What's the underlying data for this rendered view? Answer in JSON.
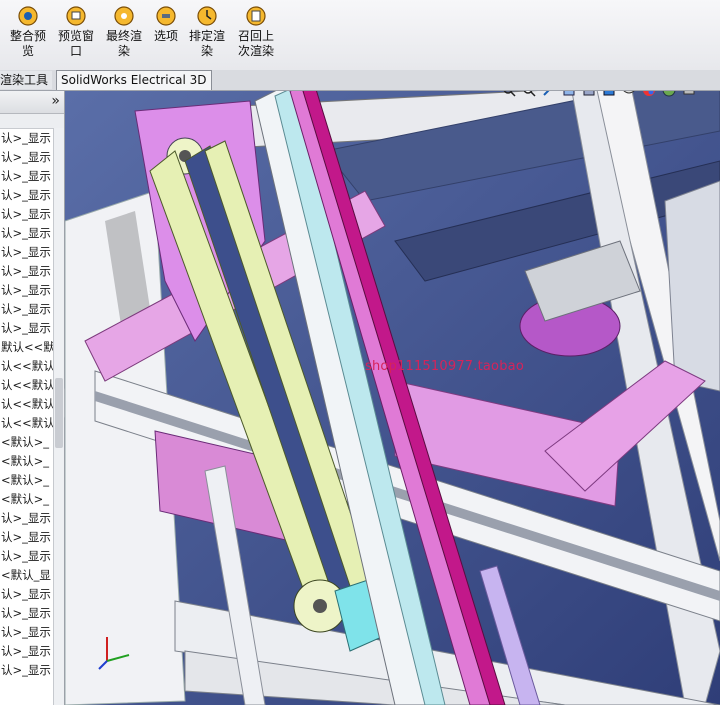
{
  "ribbon": {
    "buttons": [
      {
        "label": "整合预\n览",
        "icon": "integrated-preview-icon"
      },
      {
        "label": "预览窗\n口",
        "icon": "preview-window-icon"
      },
      {
        "label": "最终渲\n染",
        "icon": "final-render-icon"
      },
      {
        "label": "选项",
        "icon": "options-icon"
      },
      {
        "label": "排定渲\n染",
        "icon": "schedule-render-icon"
      },
      {
        "label": "召回上\n次渲染",
        "icon": "recall-render-icon"
      }
    ]
  },
  "tabs": [
    {
      "label": "渲染工具"
    },
    {
      "label": "SolidWorks Electrical 3D"
    }
  ],
  "tree": {
    "collapse_label": "»",
    "rows": [
      "认>_显示",
      "认>_显示",
      "认>_显示",
      "认>_显示",
      "认>_显示",
      "认>_显示",
      "认>_显示",
      "认>_显示",
      "认>_显示",
      "认>_显示",
      "认>_显示",
      "默认<<默",
      "认<<默认",
      "认<<默认",
      "认<<默认",
      "认<<默认",
      "<默认>_",
      "<默认>_",
      "<默认>_",
      "<默认>_",
      "认>_显示",
      "认>_显示",
      "认>_显示",
      "<默认_显",
      "认>_显示",
      "认>_显示",
      "认>_显示",
      "认>_显示",
      "认>_显示"
    ]
  },
  "viewport": {
    "watermark": "shop111510977.taobao",
    "tools": [
      "zoom-fit-icon",
      "zoom-area-icon",
      "previous-view-icon",
      "section-view-icon",
      "view-orientation-icon",
      "display-style-icon",
      "hide-show-icon",
      "edit-appearance-icon",
      "scene-icon",
      "view-settings-icon"
    ]
  },
  "colors": {
    "plate": "#d98ee8",
    "rail_pink": "#e07ad6",
    "rail_magenta": "#c2188a",
    "belt": "#e6f0b4",
    "frame": "#f3f4f6",
    "cyan": "#7fe3ea",
    "background": "#3d4f8c"
  }
}
